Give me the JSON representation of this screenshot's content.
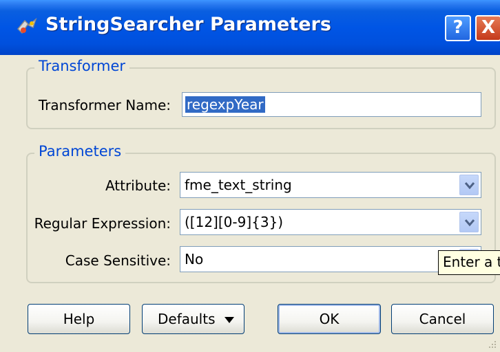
{
  "window": {
    "title": "StringSearcher Parameters",
    "help_label": "?",
    "close_label": "X"
  },
  "transformer_group": {
    "legend": "Transformer",
    "name_label": "Transformer Name:",
    "name_value": "regexpYear"
  },
  "parameters_group": {
    "legend": "Parameters",
    "attribute_label": "Attribute:",
    "attribute_value": "fme_text_string",
    "regex_label": "Regular Expression:",
    "regex_value": "([12][0-9]{3})",
    "case_label": "Case Sensitive:",
    "case_value": "No"
  },
  "tooltip": {
    "text": "Enter a t"
  },
  "buttons": {
    "help": "Help",
    "defaults": "Defaults",
    "ok": "OK",
    "cancel": "Cancel"
  },
  "colors": {
    "title_bar": "#0055e5",
    "group_legend": "#0046d5",
    "selection": "#316ac5",
    "dialog_bg": "#ece9d8"
  },
  "icons": [
    "app-icon",
    "help-icon",
    "close-icon",
    "chevron-down-icon",
    "caret-down-icon",
    "resize-grip-icon"
  ]
}
